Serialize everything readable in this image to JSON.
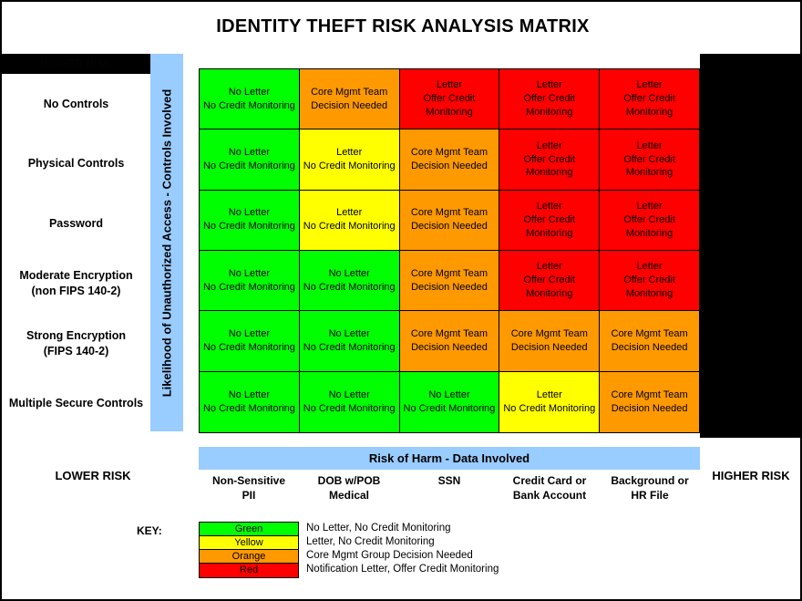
{
  "title": "IDENTITY THEFT RISK ANALYSIS MATRIX",
  "hidden_top_left_label": "HIGHER RISK",
  "y_axis": {
    "label": "Likelihood of Unauthorized Access - Controls Involved",
    "rows": [
      "No Controls",
      "Physical Controls",
      "Password",
      "Moderate Encryption\n(non FIPS 140-2)",
      "Strong Encryption\n(FIPS 140-2)",
      "Multiple Secure Controls"
    ]
  },
  "x_axis": {
    "banner": "Risk of Harm - Data Involved",
    "columns": [
      "Non-Sensitive\nPII",
      "DOB w/POB\nMedical",
      "SSN",
      "Credit Card or\nBank Account",
      "Background or\nHR File"
    ],
    "lower_risk": "LOWER RISK",
    "higher_risk": "HIGHER RISK"
  },
  "labels": {
    "green_text": "No Letter\nNo Credit Monitoring",
    "yellow_text": "Letter\nNo Credit Monitoring",
    "orange_text": "Core Mgmt Team\nDecision Needed",
    "red_text": "Letter\nOffer Credit\nMonitoring"
  },
  "colors": {
    "green": "#00ff00",
    "yellow": "#ffff00",
    "orange": "#ff9900",
    "red": "#ff0000",
    "accent_blue": "#99ccff",
    "black": "#000000"
  },
  "chart_data": {
    "type": "heatmap",
    "title": "IDENTITY THEFT RISK ANALYSIS MATRIX",
    "xlabel": "Risk of Harm - Data Involved",
    "ylabel": "Likelihood of Unauthorized Access - Controls Involved",
    "x_categories": [
      "Non-Sensitive PII",
      "DOB w/POB Medical",
      "SSN",
      "Credit Card or Bank Account",
      "Background or HR File"
    ],
    "y_categories": [
      "No Controls",
      "Physical Controls",
      "Password",
      "Moderate Encryption (non FIPS 140-2)",
      "Strong Encryption (FIPS 140-2)",
      "Multiple Secure Controls"
    ],
    "grid": true,
    "legend_position": "bottom",
    "rows": [
      {
        "label": "No Controls",
        "cells": [
          {
            "color": "green",
            "text": "No Letter\nNo Credit Monitoring"
          },
          {
            "color": "orange",
            "text": "Core Mgmt Team\nDecision Needed"
          },
          {
            "color": "red",
            "text": "Letter\nOffer Credit\nMonitoring"
          },
          {
            "color": "red",
            "text": "Letter\nOffer Credit\nMonitoring"
          },
          {
            "color": "red",
            "text": "Letter\nOffer Credit\nMonitoring"
          }
        ]
      },
      {
        "label": "Physical Controls",
        "cells": [
          {
            "color": "green",
            "text": "No Letter\nNo Credit Monitoring"
          },
          {
            "color": "yellow",
            "text": "Letter\nNo Credit Monitoring"
          },
          {
            "color": "orange",
            "text": "Core Mgmt Team\nDecision Needed"
          },
          {
            "color": "red",
            "text": "Letter\nOffer Credit\nMonitoring"
          },
          {
            "color": "red",
            "text": "Letter\nOffer Credit\nMonitoring"
          }
        ]
      },
      {
        "label": "Password",
        "cells": [
          {
            "color": "green",
            "text": "No Letter\nNo Credit Monitoring"
          },
          {
            "color": "yellow",
            "text": "Letter\nNo Credit Monitoring"
          },
          {
            "color": "orange",
            "text": "Core Mgmt Team\nDecision Needed"
          },
          {
            "color": "red",
            "text": "Letter\nOffer Credit\nMonitoring"
          },
          {
            "color": "red",
            "text": "Letter\nOffer Credit\nMonitoring"
          }
        ]
      },
      {
        "label": "Moderate Encryption (non FIPS 140-2)",
        "cells": [
          {
            "color": "green",
            "text": "No Letter\nNo Credit Monitoring"
          },
          {
            "color": "green",
            "text": "No Letter\nNo Credit Monitoring"
          },
          {
            "color": "orange",
            "text": "Core Mgmt Team\nDecision Needed"
          },
          {
            "color": "red",
            "text": "Letter\nOffer Credit\nMonitoring"
          },
          {
            "color": "red",
            "text": "Letter\nOffer Credit\nMonitoring"
          }
        ]
      },
      {
        "label": "Strong Encryption (FIPS 140-2)",
        "cells": [
          {
            "color": "green",
            "text": "No Letter\nNo Credit Monitoring"
          },
          {
            "color": "green",
            "text": "No Letter\nNo Credit Monitoring"
          },
          {
            "color": "orange",
            "text": "Core Mgmt Team\nDecision Needed"
          },
          {
            "color": "orange",
            "text": "Core Mgmt Team\nDecision Needed"
          },
          {
            "color": "orange",
            "text": "Core Mgmt Team\nDecision Needed"
          }
        ]
      },
      {
        "label": "Multiple Secure Controls",
        "cells": [
          {
            "color": "green",
            "text": "No Letter\nNo Credit Monitoring"
          },
          {
            "color": "green",
            "text": "No Letter\nNo Credit Monitoring"
          },
          {
            "color": "green",
            "text": "No Letter\nNo Credit Monitoring"
          },
          {
            "color": "yellow",
            "text": "Letter\nNo Credit Monitoring"
          },
          {
            "color": "orange",
            "text": "Core Mgmt Team\nDecision Needed"
          }
        ]
      }
    ]
  },
  "key": {
    "label": "KEY:",
    "entries": [
      {
        "swatch": "Green",
        "color": "green",
        "description": "No Letter, No Credit Monitoring"
      },
      {
        "swatch": "Yellow",
        "color": "yellow",
        "description": "Letter, No Credit Monitoring"
      },
      {
        "swatch": "Orange",
        "color": "orange",
        "description": "Core Mgmt Group Decision Needed"
      },
      {
        "swatch": "Red",
        "color": "red",
        "description": "Notification Letter, Offer Credit Monitoring"
      }
    ]
  }
}
